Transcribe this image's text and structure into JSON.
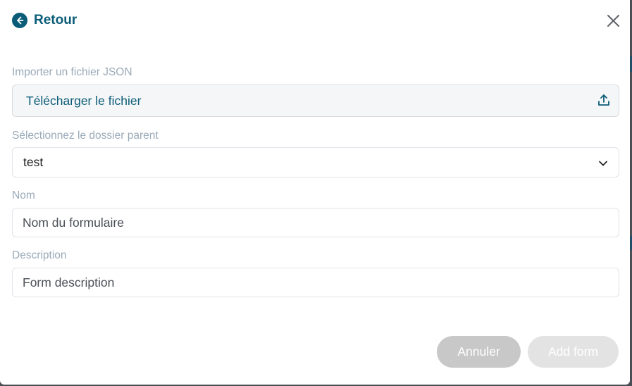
{
  "header": {
    "back_label": "Retour"
  },
  "form": {
    "import": {
      "label": "Importer un fichier JSON",
      "button_text": "Télécharger le fichier"
    },
    "parent_folder": {
      "label": "Sélectionnez le dossier parent",
      "value": "test"
    },
    "name": {
      "label": "Nom",
      "placeholder": "Nom du formulaire",
      "value": ""
    },
    "description": {
      "label": "Description",
      "placeholder": "Form description",
      "value": ""
    }
  },
  "footer": {
    "cancel_label": "Annuler",
    "submit_label": "Add form"
  },
  "colors": {
    "accent": "#0b5c77",
    "label": "#9aaab8",
    "cancel_bg": "#c8c8c8",
    "submit_bg": "#e3e3e3"
  },
  "icons": {
    "back": "arrow-left-circle-icon",
    "close": "close-icon",
    "upload": "upload-icon",
    "dropdown": "chevron-down-icon"
  }
}
